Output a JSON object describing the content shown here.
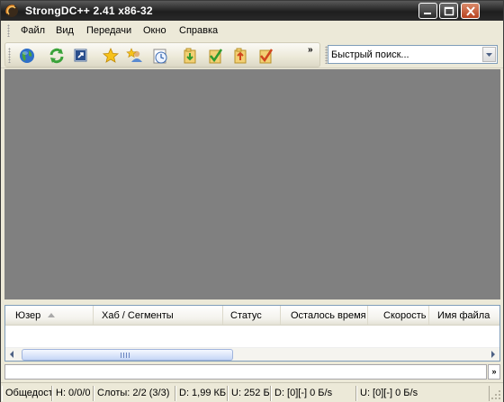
{
  "window": {
    "title": "StrongDC++ 2.41 x86-32"
  },
  "menu": [
    "Файл",
    "Вид",
    "Передачи",
    "Окно",
    "Справка"
  ],
  "toolbar": {
    "icons": [
      "globe-icon",
      "refresh-icon",
      "shortcut-icon",
      "favorites-star-icon",
      "favorite-users-icon",
      "queue-clock-icon",
      "download-folder-icon",
      "finished-downloads-icon",
      "upload-folder-icon",
      "finished-uploads-icon"
    ],
    "overflow_label": "»"
  },
  "quick_search": {
    "placeholder": "Быстрый поиск..."
  },
  "transfers": {
    "columns": [
      "Юзер",
      "Хаб / Сегменты",
      "Статус",
      "Осталось время",
      "Скорость",
      "Имя файла"
    ],
    "rows": []
  },
  "lower_overflow_label": "»",
  "statusbar": {
    "cells": [
      "Общедост",
      "H: 0/0/0",
      "Слоты: 2/2 (3/3)",
      "D: 1,99 КБ",
      "U: 252 Б",
      "D: [0][-] 0 Б/s",
      "U: [0][-] 0 Б/s"
    ]
  },
  "colors": {
    "mdi_background": "#808080",
    "titlebar": "#2a2a2a",
    "window_face": "#ece9d8"
  }
}
